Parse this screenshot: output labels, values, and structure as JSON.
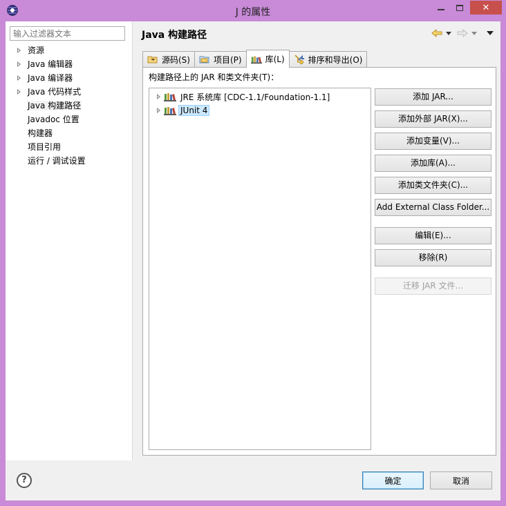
{
  "window": {
    "title": "J 的属性",
    "close_glyph": "✕"
  },
  "filter": {
    "placeholder": "输入过滤器文本"
  },
  "nav": {
    "items": [
      {
        "label": "资源",
        "expandable": true
      },
      {
        "label": "Java 编辑器",
        "expandable": true
      },
      {
        "label": "Java 编译器",
        "expandable": true
      },
      {
        "label": "Java 代码样式",
        "expandable": true
      },
      {
        "label": "Java 构建路径",
        "expandable": false,
        "selected": true
      },
      {
        "label": "Javadoc 位置",
        "expandable": false
      },
      {
        "label": "构建器",
        "expandable": false
      },
      {
        "label": "项目引用",
        "expandable": false
      },
      {
        "label": "运行 / 调试设置",
        "expandable": false
      }
    ]
  },
  "page": {
    "title": "Java 构建路径",
    "icons": [
      "back-arrow-icon",
      "forward-arrow-icon",
      "view-menu-icon"
    ]
  },
  "tabs": [
    {
      "label": "源码(S)",
      "icon": "source-folder-icon",
      "active": false
    },
    {
      "label": "项目(P)",
      "icon": "project-folder-icon",
      "active": false
    },
    {
      "label": "库(L)",
      "icon": "library-icon",
      "active": true
    },
    {
      "label": "排序和导出(O)",
      "icon": "order-export-icon",
      "active": false
    }
  ],
  "libraries": {
    "label": "构建路径上的 JAR 和类文件夹(T)：",
    "items": [
      {
        "label": "JRE 系统库 [CDC-1.1/Foundation-1.1]",
        "selected": false
      },
      {
        "label": "JUnit 4",
        "selected": true
      }
    ]
  },
  "buttons": {
    "add_jar": "添加 JAR...",
    "add_external_jar": "添加外部 JAR(X)...",
    "add_variable": "添加变量(V)...",
    "add_library": "添加库(A)...",
    "add_class_folder": "添加类文件夹(C)...",
    "add_external_class_folder": "Add External Class Folder...",
    "edit": "编辑(E)...",
    "remove": "移除(R)",
    "migrate_jar": "迁移 JAR 文件..."
  },
  "footer": {
    "help_glyph": "?",
    "ok": "确定",
    "cancel": "取消"
  },
  "colors": {
    "window_frame": "#c98ad8",
    "close_button": "#c7504c",
    "selection": "#cce8ff"
  }
}
